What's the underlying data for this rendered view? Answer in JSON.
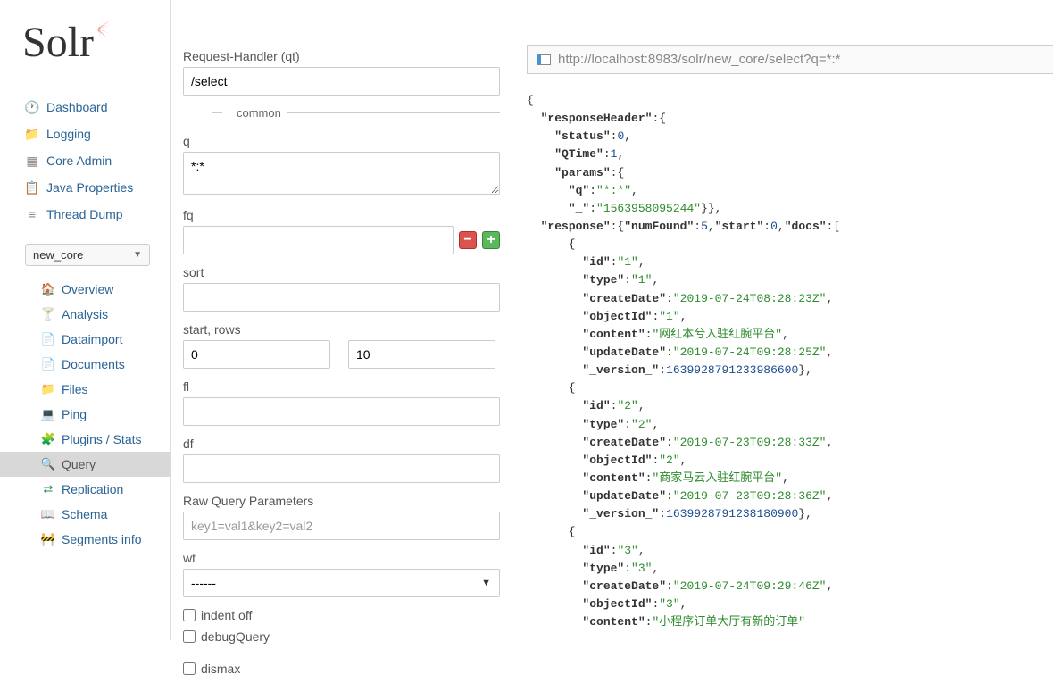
{
  "logo": {
    "text": "Solr"
  },
  "nav": [
    {
      "label": "Dashboard",
      "icon": "🕐"
    },
    {
      "label": "Logging",
      "icon": "📁"
    },
    {
      "label": "Core Admin",
      "icon": "▦"
    },
    {
      "label": "Java Properties",
      "icon": "📋"
    },
    {
      "label": "Thread Dump",
      "icon": "≡"
    }
  ],
  "core_select": {
    "value": "new_core"
  },
  "sub_nav": [
    {
      "label": "Overview",
      "icon": "🏠"
    },
    {
      "label": "Analysis",
      "icon": "🍸"
    },
    {
      "label": "Dataimport",
      "icon": "📄"
    },
    {
      "label": "Documents",
      "icon": "📄"
    },
    {
      "label": "Files",
      "icon": "📁"
    },
    {
      "label": "Ping",
      "icon": "💻"
    },
    {
      "label": "Plugins / Stats",
      "icon": "🧩"
    },
    {
      "label": "Query",
      "icon": "🔍",
      "active": true
    },
    {
      "label": "Replication",
      "icon": "⇄"
    },
    {
      "label": "Schema",
      "icon": "📖"
    },
    {
      "label": "Segments info",
      "icon": "🚧"
    }
  ],
  "form": {
    "qt": {
      "label": "Request-Handler (qt)",
      "value": "/select"
    },
    "common_legend": "common",
    "q": {
      "label": "q",
      "value": "*:*"
    },
    "fq": {
      "label": "fq",
      "value": ""
    },
    "sort": {
      "label": "sort",
      "value": ""
    },
    "start_rows": {
      "label": "start, rows",
      "start": "0",
      "rows": "10"
    },
    "fl": {
      "label": "fl",
      "value": ""
    },
    "df": {
      "label": "df",
      "value": ""
    },
    "raw": {
      "label": "Raw Query Parameters",
      "placeholder": "key1=val1&key2=val2",
      "value": ""
    },
    "wt": {
      "label": "wt",
      "value": "------"
    },
    "indent_off": "indent off",
    "debug_query": "debugQuery",
    "dismax": "dismax"
  },
  "output": {
    "url": "http://localhost:8983/solr/new_core/select?q=*:*",
    "json": {
      "responseHeader": {
        "status": 0,
        "QTime": 1,
        "params": {
          "q": "*:*",
          "_": "1563958095244"
        }
      },
      "response": {
        "numFound": 5,
        "start": 0,
        "docs": [
          {
            "id": "1",
            "type": "1",
            "createDate": "2019-07-24T08:28:23Z",
            "objectId": "1",
            "content": "网红本兮入驻红腕平台",
            "updateDate": "2019-07-24T09:28:25Z",
            "_version_": 1639928791233986560
          },
          {
            "id": "2",
            "type": "2",
            "createDate": "2019-07-23T09:28:33Z",
            "objectId": "2",
            "content": "商家马云入驻红腕平台",
            "updateDate": "2019-07-23T09:28:36Z",
            "_version_": 1639928791238180864
          },
          {
            "id": "3",
            "type": "3",
            "createDate": "2019-07-24T09:29:46Z",
            "objectId": "3",
            "content": "小程序订单大厅有新的订单"
          }
        ]
      }
    }
  }
}
